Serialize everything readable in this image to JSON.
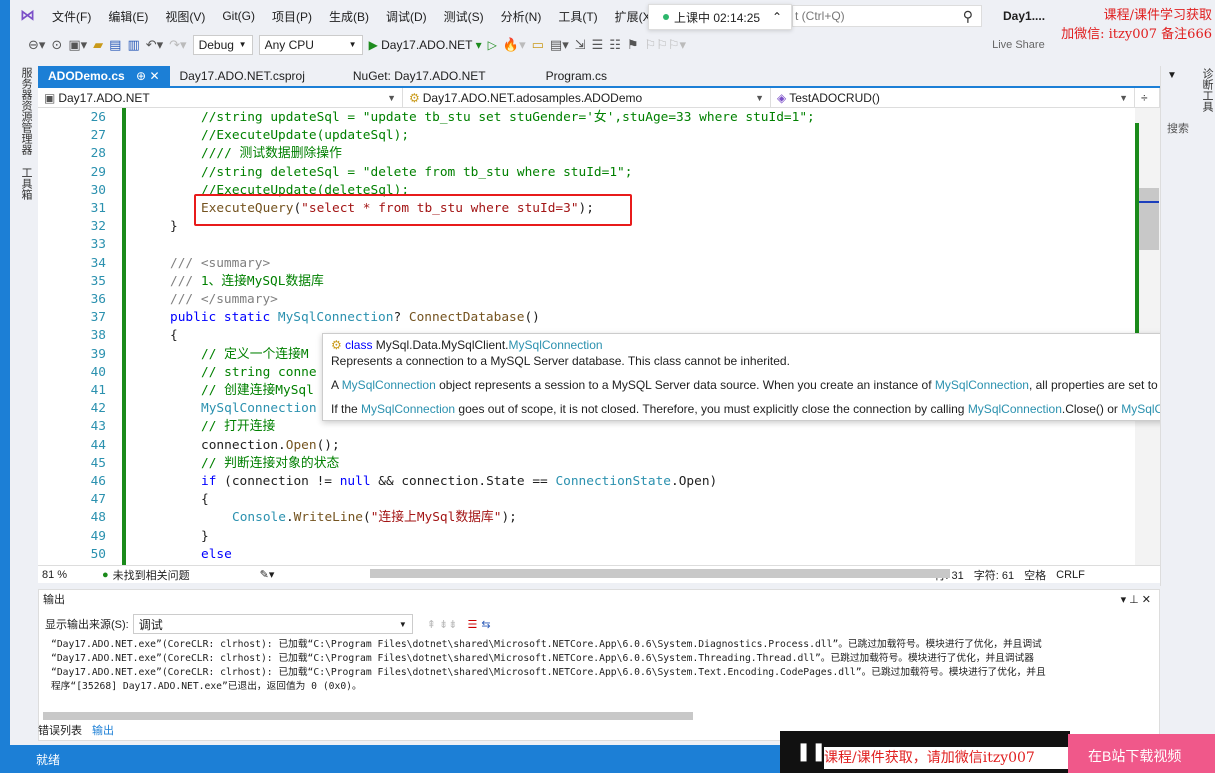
{
  "menu": {
    "items": [
      "文件(F)",
      "编辑(E)",
      "视图(V)",
      "Git(G)",
      "项目(P)",
      "生成(B)",
      "调试(D)",
      "测试(S)",
      "分析(N)",
      "工具(T)",
      "扩展(X)"
    ]
  },
  "session": {
    "label": "上课中 02:14:25"
  },
  "search": {
    "placeholder": "t (Ctrl+Q)"
  },
  "solution_title": "Day1....",
  "watermark": {
    "line1": "课程/课件学习获取",
    "line2": "加微信: itzy007 备注666"
  },
  "toolbar": {
    "config": "Debug",
    "platform": "Any CPU",
    "run_target": "Day17.ADO.NET",
    "live_share": "Live Share"
  },
  "sidestrip": {
    "items": [
      "服务器资源管理器",
      "工具箱"
    ]
  },
  "right_panel": {
    "title": "诊断工具",
    "search": "搜索"
  },
  "tabs": [
    {
      "label": "ADODemo.cs",
      "active": true
    },
    {
      "label": "Day17.ADO.NET.csproj"
    },
    {
      "label": "NuGet: Day17.ADO.NET"
    },
    {
      "label": "Program.cs"
    }
  ],
  "nav": {
    "project": "Day17.ADO.NET",
    "class": "Day17.ADO.NET.adosamples.ADODemo",
    "member": "TestADOCRUD()"
  },
  "code": [
    {
      "n": "26",
      "i": 3,
      "t": [
        [
          "comment",
          "//string updateSql = \"update tb_stu set stuGender='女',stuAge=33 where stuId=1\";"
        ]
      ]
    },
    {
      "n": "27",
      "i": 3,
      "t": [
        [
          "comment",
          "//ExecuteUpdate(updateSql);"
        ]
      ]
    },
    {
      "n": "28",
      "i": 3,
      "t": [
        [
          "comment",
          "//// 测试数据删除操作"
        ]
      ]
    },
    {
      "n": "29",
      "i": 3,
      "t": [
        [
          "comment",
          "//string deleteSql = \"delete from tb_stu where stuId=1\";"
        ]
      ]
    },
    {
      "n": "30",
      "i": 3,
      "t": [
        [
          "comment",
          "//ExecuteUpdate(deleteSql);"
        ]
      ]
    },
    {
      "n": "31",
      "i": 3,
      "t": [
        [
          "method",
          "ExecuteQuery"
        ],
        [
          "plain",
          "("
        ],
        [
          "str",
          "\"select * from tb_stu where stuId=3\""
        ],
        [
          "plain",
          ");"
        ]
      ]
    },
    {
      "n": "32",
      "i": 2,
      "t": [
        [
          "plain",
          "}"
        ]
      ]
    },
    {
      "n": "33",
      "i": 0,
      "t": []
    },
    {
      "n": "34",
      "i": 2,
      "t": [
        [
          "doc",
          "/// <summary>"
        ]
      ]
    },
    {
      "n": "35",
      "i": 2,
      "t": [
        [
          "doc",
          "/// "
        ],
        [
          "comment",
          "1、连接MySQL数据库"
        ]
      ]
    },
    {
      "n": "36",
      "i": 2,
      "t": [
        [
          "doc",
          "/// </summary>"
        ]
      ]
    },
    {
      "n": "37",
      "i": 2,
      "t": [
        [
          "kw",
          "public static "
        ],
        [
          "type",
          "MySqlConnection"
        ],
        [
          "plain",
          "? "
        ],
        [
          "method",
          "ConnectDatabase"
        ],
        [
          "plain",
          "()"
        ]
      ]
    },
    {
      "n": "38",
      "i": 2,
      "t": [
        [
          "plain",
          "{"
        ]
      ]
    },
    {
      "n": "39",
      "i": 3,
      "t": [
        [
          "comment",
          "// 定义一个连接M"
        ]
      ]
    },
    {
      "n": "40",
      "i": 3,
      "t": [
        [
          "comment",
          "// string conne"
        ]
      ]
    },
    {
      "n": "41",
      "i": 3,
      "t": [
        [
          "comment",
          "// 创建连接MySql"
        ]
      ]
    },
    {
      "n": "42",
      "i": 3,
      "t": [
        [
          "type",
          "MySqlConnection"
        ]
      ]
    },
    {
      "n": "43",
      "i": 3,
      "t": [
        [
          "comment",
          "// 打开连接"
        ]
      ]
    },
    {
      "n": "44",
      "i": 3,
      "t": [
        [
          "plain",
          "connection."
        ],
        [
          "method",
          "Open"
        ],
        [
          "plain",
          "();"
        ]
      ]
    },
    {
      "n": "45",
      "i": 3,
      "t": [
        [
          "comment",
          "// 判断连接对象的状态"
        ]
      ]
    },
    {
      "n": "46",
      "i": 3,
      "t": [
        [
          "kw",
          "if "
        ],
        [
          "plain",
          "(connection != "
        ],
        [
          "kw",
          "null"
        ],
        [
          "plain",
          " && connection.State == "
        ],
        [
          "type",
          "ConnectionState"
        ],
        [
          "plain",
          ".Open)"
        ]
      ]
    },
    {
      "n": "47",
      "i": 3,
      "t": [
        [
          "plain",
          "{"
        ]
      ]
    },
    {
      "n": "48",
      "i": 4,
      "t": [
        [
          "type",
          "Console"
        ],
        [
          "plain",
          "."
        ],
        [
          "method",
          "WriteLine"
        ],
        [
          "plain",
          "("
        ],
        [
          "str",
          "\"连接上MySql数据库\""
        ],
        [
          "plain",
          ");"
        ]
      ]
    },
    {
      "n": "49",
      "i": 3,
      "t": [
        [
          "plain",
          "}"
        ]
      ]
    },
    {
      "n": "50",
      "i": 3,
      "t": [
        [
          "kw",
          "else"
        ]
      ]
    }
  ],
  "tooltip": {
    "kind": "class",
    "namespace": "MySql.Data.MySqlClient.",
    "name": "MySqlConnection",
    "summary": "Represents a connection to a MySQL Server database. This class cannot be inherited.",
    "p1a": "A ",
    "p1b": "MySqlConnection",
    "p1c": " object represents a session to a MySQL Server data source. When you create an instance of ",
    "p1d": "MySqlConnection",
    "p1e": ", all properties are set to their in",
    "p2a": "If the ",
    "p2b": "MySqlConnection",
    "p2c": " goes out of scope, it is not closed. Therefore, you must explicitly close the connection by calling ",
    "p2d": "MySqlConnection",
    "p2e": ".Close() or ",
    "p2f": "MySqlConne"
  },
  "editor_status": {
    "zoom": "81 %",
    "issues": "未找到相关问题",
    "line": "行: 31",
    "char": "字符: 61",
    "spaces": "空格",
    "eol": "CRLF"
  },
  "output": {
    "title": "输出",
    "source_label": "显示输出来源(S):",
    "source_value": "调试",
    "lines": [
      "“Day17.ADO.NET.exe”(CoreCLR: clrhost): 已加载“C:\\Program Files\\dotnet\\shared\\Microsoft.NETCore.App\\6.0.6\\System.Diagnostics.Process.dll”。已跳过加载符号。模块进行了优化，并且调试",
      "“Day17.ADO.NET.exe”(CoreCLR: clrhost): 已加载“C:\\Program Files\\dotnet\\shared\\Microsoft.NETCore.App\\6.0.6\\System.Threading.Thread.dll”。已跳过加载符号。模块进行了优化，并且调试器",
      "“Day17.ADO.NET.exe”(CoreCLR: clrhost): 已加载“C:\\Program Files\\dotnet\\shared\\Microsoft.NETCore.App\\6.0.6\\System.Text.Encoding.CodePages.dll”。已跳过加载符号。模块进行了优化，并且",
      "程序“[35268] Day17.ADO.NET.exe”已退出，返回值为 0 (0x0)。"
    ]
  },
  "bottom_tabs": [
    "错误列表",
    "输出"
  ],
  "status": {
    "text": "就绪"
  },
  "overlay": {
    "ad": "课程/课件获取，请加微信itzy007",
    "pink": "在B站下载视频"
  },
  "colors": {
    "accent": "#1c7fd6",
    "highlight_box": "#e81b1b"
  }
}
